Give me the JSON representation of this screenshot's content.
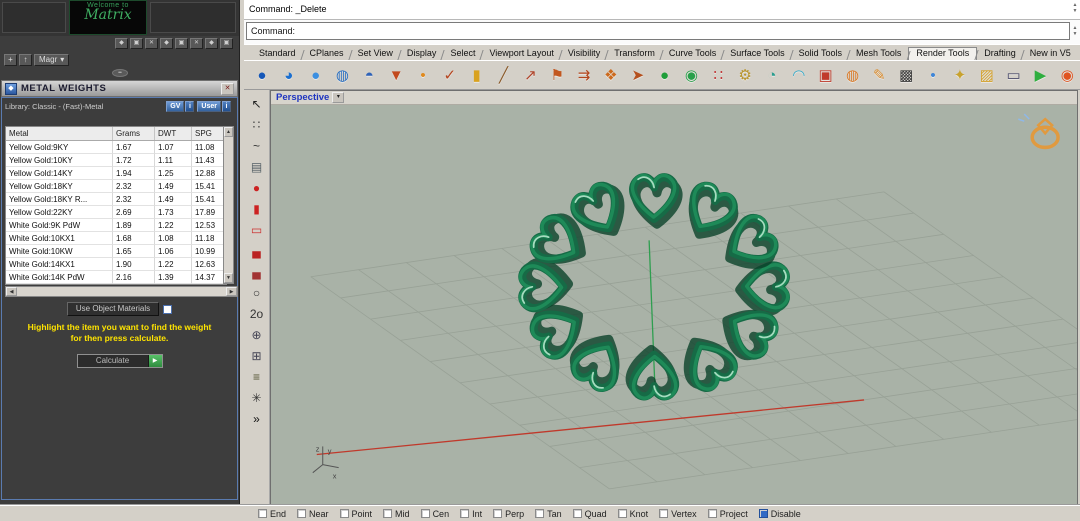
{
  "palette": {
    "panel_bg": "#3d3d3d",
    "chrome": "#d4d0c8",
    "viewport_bg": "#a9b2a7",
    "ring_green": "#166b46",
    "axis_red": "#c0392b",
    "axis_green": "#2e9e4f",
    "instruction_yellow": "#ffe400",
    "accent_blue": "#316ac5"
  },
  "left_panel": {
    "logo": {
      "line1": "Welcome to",
      "line2": "Matrix"
    },
    "dock_buttons": [
      "◆",
      "▣",
      "✕",
      "◆",
      "▣",
      "✕",
      "◆",
      "▣"
    ],
    "toolbar2": {
      "plus": "+",
      "up": "↑",
      "magr": "Magr",
      "dropdown": "▾"
    },
    "collapse_glyph": "••",
    "metal_weights": {
      "title": "METAL WEIGHTS",
      "icon_glyph": "◆",
      "close_glyph": "✕",
      "library_label": "Library: Classic - (Fast)-Metal",
      "gv_label": "GV",
      "user_label": "User",
      "info_glyph": "i",
      "table": {
        "headers": [
          "Metal",
          "Grams",
          "DWT",
          "SPG"
        ],
        "rows": [
          {
            "metal": "Yellow Gold:9KY",
            "grams": "1.67",
            "dwt": "1.07",
            "spg": "11.08"
          },
          {
            "metal": "Yellow Gold:10KY",
            "grams": "1.72",
            "dwt": "1.11",
            "spg": "11.43"
          },
          {
            "metal": "Yellow Gold:14KY",
            "grams": "1.94",
            "dwt": "1.25",
            "spg": "12.88"
          },
          {
            "metal": "Yellow Gold:18KY",
            "grams": "2.32",
            "dwt": "1.49",
            "spg": "15.41"
          },
          {
            "metal": "Yellow Gold:18KY R...",
            "grams": "2.32",
            "dwt": "1.49",
            "spg": "15.41"
          },
          {
            "metal": "Yellow Gold:22KY",
            "grams": "2.69",
            "dwt": "1.73",
            "spg": "17.89"
          },
          {
            "metal": "White Gold:9K PdW",
            "grams": "1.89",
            "dwt": "1.22",
            "spg": "12.53"
          },
          {
            "metal": "White Gold:10KX1",
            "grams": "1.68",
            "dwt": "1.08",
            "spg": "11.18"
          },
          {
            "metal": "White Gold:10KW",
            "grams": "1.65",
            "dwt": "1.06",
            "spg": "10.99"
          },
          {
            "metal": "White Gold:14KX1",
            "grams": "1.90",
            "dwt": "1.22",
            "spg": "12.63"
          },
          {
            "metal": "White Gold:14K PdW",
            "grams": "2.16",
            "dwt": "1.39",
            "spg": "14.37"
          }
        ]
      },
      "scroll": {
        "up": "▲",
        "down": "▼",
        "left": "◀",
        "right": "▶"
      },
      "use_materials_label": "Use Object Materials",
      "instruction1": "Highlight the item you want to find the weight",
      "instruction2": "for then press calculate.",
      "calculate_label": "Calculate",
      "calculate_glyph": "▶"
    }
  },
  "command_area": {
    "history": "Command: _Delete",
    "prompt": "Command:",
    "scroll_up": "▲",
    "scroll_down": "▼"
  },
  "tab_bar": {
    "tabs": [
      {
        "label": "Standard",
        "active": false
      },
      {
        "label": "CPlanes",
        "active": false
      },
      {
        "label": "Set View",
        "active": false
      },
      {
        "label": "Display",
        "active": false
      },
      {
        "label": "Select",
        "active": false
      },
      {
        "label": "Viewport Layout",
        "active": false
      },
      {
        "label": "Visibility",
        "active": false
      },
      {
        "label": "Transform",
        "active": false
      },
      {
        "label": "Curve Tools",
        "active": false
      },
      {
        "label": "Surface Tools",
        "active": false
      },
      {
        "label": "Solid Tools",
        "active": false
      },
      {
        "label": "Mesh Tools",
        "active": false
      },
      {
        "label": "Render Tools",
        "active": true
      },
      {
        "label": "Drafting",
        "active": false
      },
      {
        "label": "New in V5",
        "active": false
      }
    ]
  },
  "ribbon_icons": [
    {
      "name": "render-icon",
      "glyph": "●",
      "color": "#1557b8"
    },
    {
      "name": "render-preview-icon",
      "glyph": "◕",
      "color": "#1b6fd0"
    },
    {
      "name": "shaded-sphere-icon",
      "glyph": "●",
      "color": "#3c8fe0"
    },
    {
      "name": "wire-sphere-icon",
      "glyph": "◍",
      "color": "#2a6fc0"
    },
    {
      "name": "render-mesh-icon",
      "glyph": "◓",
      "color": "#2f63b8"
    },
    {
      "name": "cone-pick-icon",
      "glyph": "▼",
      "color": "#c24a1e"
    },
    {
      "name": "point-dot-icon",
      "glyph": "•",
      "color": "#e08a1e"
    },
    {
      "name": "check-curve-icon",
      "glyph": "✓",
      "color": "#b5451f"
    },
    {
      "name": "swatch-icon",
      "glyph": "▮",
      "color": "#d9a21f"
    },
    {
      "name": "line-pencil-icon",
      "glyph": "╱",
      "color": "#8a5a2a"
    },
    {
      "name": "arrow-curve-icon",
      "glyph": "↗",
      "color": "#b0442a"
    },
    {
      "name": "flag-icon",
      "glyph": "⚑",
      "color": "#c2571f"
    },
    {
      "name": "arrows-trio-icon",
      "glyph": "⇉",
      "color": "#b3451c"
    },
    {
      "name": "spray-icon",
      "glyph": "❖",
      "color": "#cc6a1e"
    },
    {
      "name": "turn-arrow-icon",
      "glyph": "➤",
      "color": "#b5501e"
    },
    {
      "name": "green-ball-icon",
      "glyph": "●",
      "color": "#1f9e3a"
    },
    {
      "name": "spotted-ball-icon",
      "glyph": "◉",
      "color": "#28a04a"
    },
    {
      "name": "dots-red-green-icon",
      "glyph": "∷",
      "color": "#c23a3a"
    },
    {
      "name": "gears-icon",
      "glyph": "⚙",
      "color": "#b8952f"
    },
    {
      "name": "shell-icon",
      "glyph": "◔",
      "color": "#2a9d8f"
    },
    {
      "name": "arc-rainbow-icon",
      "glyph": "◠",
      "color": "#38aac8"
    },
    {
      "name": "red-monitor-icon",
      "glyph": "▣",
      "color": "#c03a2b"
    },
    {
      "name": "basketball-icon",
      "glyph": "◍",
      "color": "#d97a28"
    },
    {
      "name": "pencil-icon",
      "glyph": "✎",
      "color": "#d98a2b"
    },
    {
      "name": "checker-ball-icon",
      "glyph": "▩",
      "color": "#3a3a3a"
    },
    {
      "name": "blue-dot-icon",
      "glyph": "•",
      "color": "#3f86d8"
    },
    {
      "name": "key-icon",
      "glyph": "✦",
      "color": "#c8a22e"
    },
    {
      "name": "gold-box-icon",
      "glyph": "▨",
      "color": "#d4a12a"
    },
    {
      "name": "viewport-frame-icon",
      "glyph": "▭",
      "color": "#4a4a6a"
    },
    {
      "name": "play-monitor-icon",
      "glyph": "▶",
      "color": "#2fae3f"
    },
    {
      "name": "record-icon",
      "glyph": "◉",
      "color": "#e05320"
    }
  ],
  "side_toolbar": [
    {
      "name": "pointer-icon",
      "glyph": "↖",
      "color": "#222222"
    },
    {
      "name": "control-points-icon",
      "glyph": "∷",
      "color": "#444444"
    },
    {
      "name": "curve-tool-icon",
      "glyph": "~",
      "color": "#333333"
    },
    {
      "name": "save-disk-icon",
      "glyph": "▤",
      "color": "#556066"
    },
    {
      "name": "red-ball-icon",
      "glyph": "●",
      "color": "#cc2222"
    },
    {
      "name": "battery-icon",
      "glyph": "▮",
      "color": "#cc2222"
    },
    {
      "name": "capsule-icon",
      "glyph": "▭",
      "color": "#cc3333"
    },
    {
      "name": "car-red-icon",
      "glyph": "▄",
      "color": "#bb2222"
    },
    {
      "name": "car-dark-icon",
      "glyph": "▄",
      "color": "#a23333"
    },
    {
      "name": "ring-tool-icon",
      "glyph": "○",
      "color": "#333333"
    },
    {
      "name": "two-circle-icon",
      "glyph": "2o",
      "color": "#333333"
    },
    {
      "name": "gumball-icon",
      "glyph": "⊕",
      "color": "#444455"
    },
    {
      "name": "cage-edit-icon",
      "glyph": "⊞",
      "color": "#444455"
    },
    {
      "name": "scale-icon",
      "glyph": "≡",
      "color": "#555533"
    },
    {
      "name": "star-tool-icon",
      "glyph": "✳",
      "color": "#333333"
    },
    {
      "name": "more-tools-chevron",
      "glyph": "»",
      "color": "#111111"
    }
  ],
  "viewport": {
    "title": "Perspective",
    "dropdown_glyph": "▾",
    "axis_labels": {
      "z": "z",
      "y": "y",
      "x": "x"
    }
  },
  "status_bar": {
    "items": [
      {
        "label": "End",
        "checked": false
      },
      {
        "label": "Near",
        "checked": false
      },
      {
        "label": "Point",
        "checked": false
      },
      {
        "label": "Mid",
        "checked": false
      },
      {
        "label": "Cen",
        "checked": false
      },
      {
        "label": "Int",
        "checked": false
      },
      {
        "label": "Perp",
        "checked": false
      },
      {
        "label": "Tan",
        "checked": false
      },
      {
        "label": "Quad",
        "checked": false
      },
      {
        "label": "Knot",
        "checked": false
      },
      {
        "label": "Vertex",
        "checked": false
      },
      {
        "label": "Project",
        "checked": false
      },
      {
        "label": "Disable",
        "checked": true
      }
    ]
  }
}
